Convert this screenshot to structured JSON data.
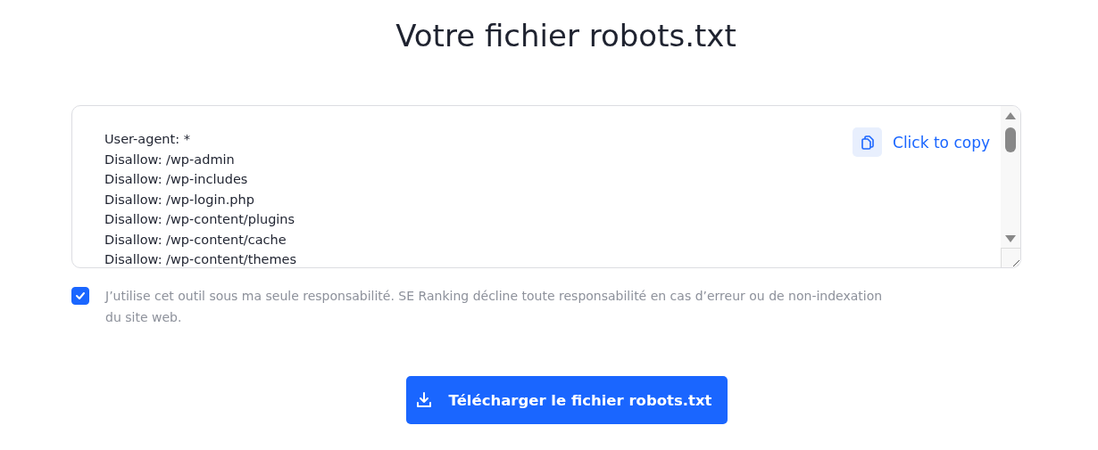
{
  "title": "Votre fichier robots.txt",
  "editor": {
    "lines": [
      "User-agent: *",
      "Disallow: /wp-admin",
      "Disallow: /wp-includes",
      "Disallow: /wp-login.php",
      "Disallow: /wp-content/plugins",
      "Disallow: /wp-content/cache",
      "Disallow: /wp-content/themes"
    ],
    "copy_label": "Click to copy"
  },
  "consent": {
    "checked": true,
    "text": "J’utilise cet outil sous ma seule responsabilité. SE Ranking décline toute responsabilité en cas d’erreur ou de non-indexation du site web."
  },
  "download_button": "Télécharger le fichier robots.txt"
}
